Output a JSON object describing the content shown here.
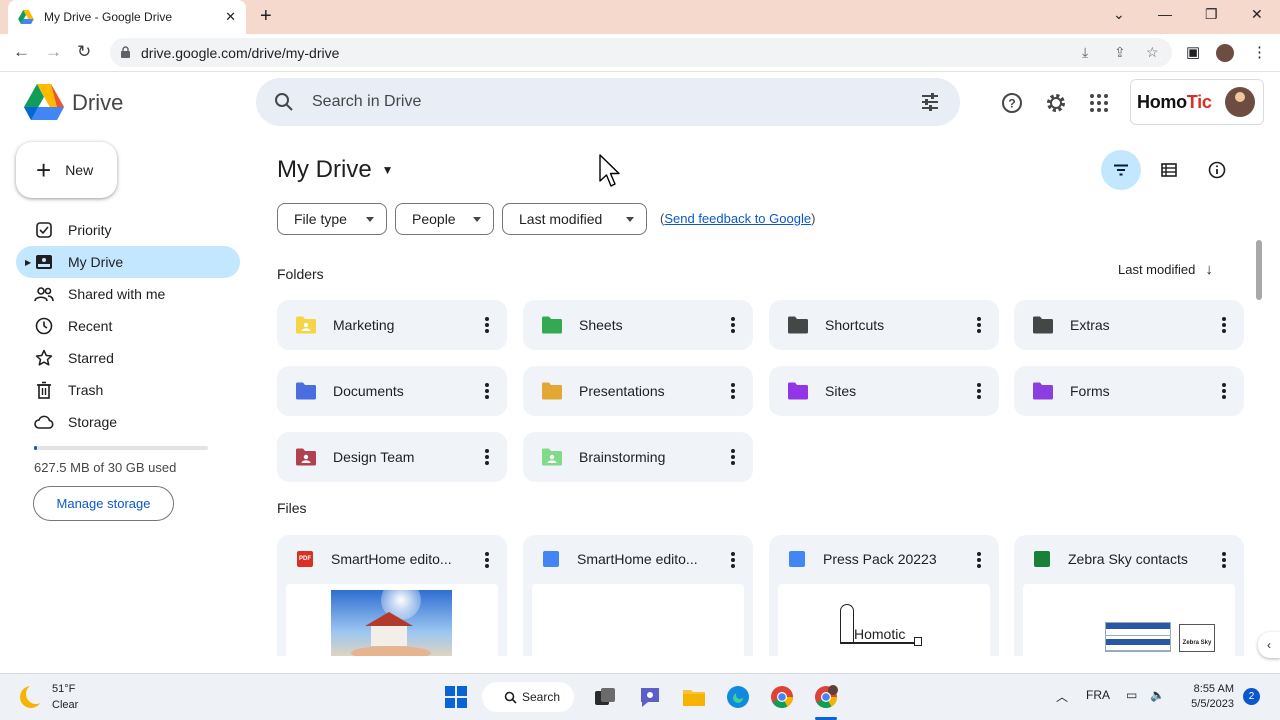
{
  "browser": {
    "tab_title": "My Drive - Google Drive",
    "url": "drive.google.com/drive/my-drive"
  },
  "app": {
    "name": "Drive",
    "search_placeholder": "Search in Drive",
    "account_brand_prefix": "Homo",
    "account_brand_suffix": "Tic"
  },
  "sidebar": {
    "new_label": "New",
    "items": [
      {
        "label": "Priority",
        "icon": "checkbox-icon"
      },
      {
        "label": "My Drive",
        "icon": "my-drive-icon",
        "active": true
      },
      {
        "label": "Shared with me",
        "icon": "people-icon"
      },
      {
        "label": "Recent",
        "icon": "clock-icon"
      },
      {
        "label": "Starred",
        "icon": "star-icon"
      },
      {
        "label": "Trash",
        "icon": "trash-icon"
      },
      {
        "label": "Storage",
        "icon": "cloud-icon"
      }
    ],
    "storage_text": "627.5 MB of 30 GB used",
    "storage_fraction": 0.02,
    "manage_storage_label": "Manage storage"
  },
  "main": {
    "title": "My Drive",
    "filters": [
      "File type",
      "People",
      "Last modified"
    ],
    "feedback_open": "(",
    "feedback_link": "Send feedback to Google",
    "feedback_close": ")",
    "folders_label": "Folders",
    "sort_label": "Last modified",
    "folders": [
      {
        "name": "Marketing",
        "color": "#f5d547",
        "shared": true
      },
      {
        "name": "Sheets",
        "color": "#34a853",
        "shared": false
      },
      {
        "name": "Shortcuts",
        "color": "#444746",
        "shared": false
      },
      {
        "name": "Extras",
        "color": "#444746",
        "shared": false
      },
      {
        "name": "Documents",
        "color": "#4a6ee0",
        "shared": false
      },
      {
        "name": "Presentations",
        "color": "#e2a833",
        "shared": false
      },
      {
        "name": "Sites",
        "color": "#9334e6",
        "shared": false
      },
      {
        "name": "Forms",
        "color": "#8c3ee0",
        "shared": false
      },
      {
        "name": "Design Team",
        "color": "#b0414f",
        "shared": true
      },
      {
        "name": "Brainstorming",
        "color": "#81d98a",
        "shared": true
      }
    ],
    "files_label": "Files",
    "files": [
      {
        "name": "SmartHome edito...",
        "icon": "pdf-icon",
        "icon_color": "#d93025",
        "icon_text": "PDF"
      },
      {
        "name": "SmartHome edito...",
        "icon": "doc-icon",
        "icon_color": "#4285f4",
        "icon_text": ""
      },
      {
        "name": "Press Pack 20223",
        "icon": "doc-shortcut-icon",
        "icon_color": "#4285f4",
        "icon_text": ""
      },
      {
        "name": "Zebra Sky contacts",
        "icon": "sheet-shortcut-icon",
        "icon_color": "#188038",
        "icon_text": ""
      }
    ],
    "thumb_homotic": "Homotic",
    "thumb_zebra": "Zebra Sky"
  },
  "taskbar": {
    "temp": "51°F",
    "condition": "Clear",
    "search_label": "Search",
    "lang": "FRA",
    "time": "8:55 AM",
    "date": "5/5/2023",
    "notifications": "2"
  }
}
